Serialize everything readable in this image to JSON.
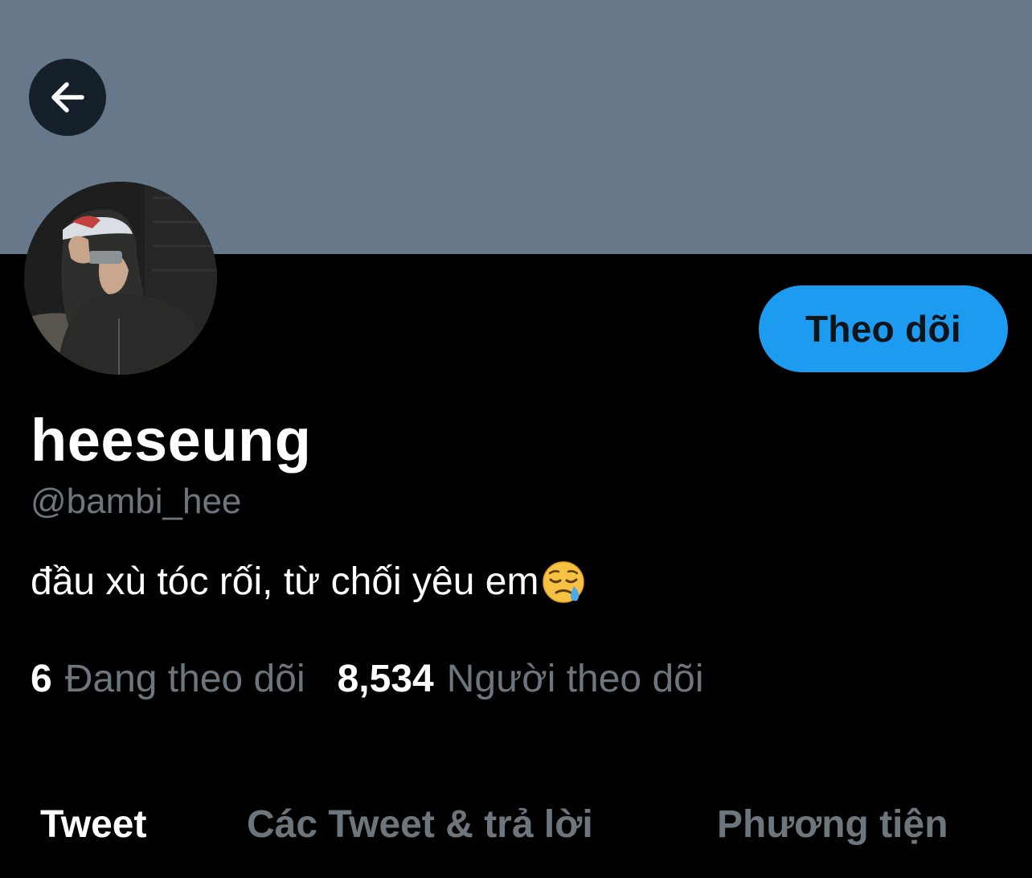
{
  "header": {
    "back_icon": "arrow-left-icon",
    "banner_color": "#66788a"
  },
  "profile": {
    "display_name": "heeseung",
    "handle": "@bambi_hee",
    "bio_text": "đầu xù tóc rối, từ chối yêu em",
    "bio_emoji": "sleepy-face-emoji",
    "follow_label": "Theo dõi",
    "accent_color": "#1d9bf0"
  },
  "stats": {
    "following_count": "6",
    "following_label": "Đang theo dõi",
    "followers_count": "8,534",
    "followers_label": "Người theo dõi"
  },
  "tabs": [
    {
      "label": "Tweet",
      "active": true
    },
    {
      "label": "Các Tweet & trả lời",
      "active": false
    },
    {
      "label": "Phương tiện",
      "active": false
    }
  ]
}
